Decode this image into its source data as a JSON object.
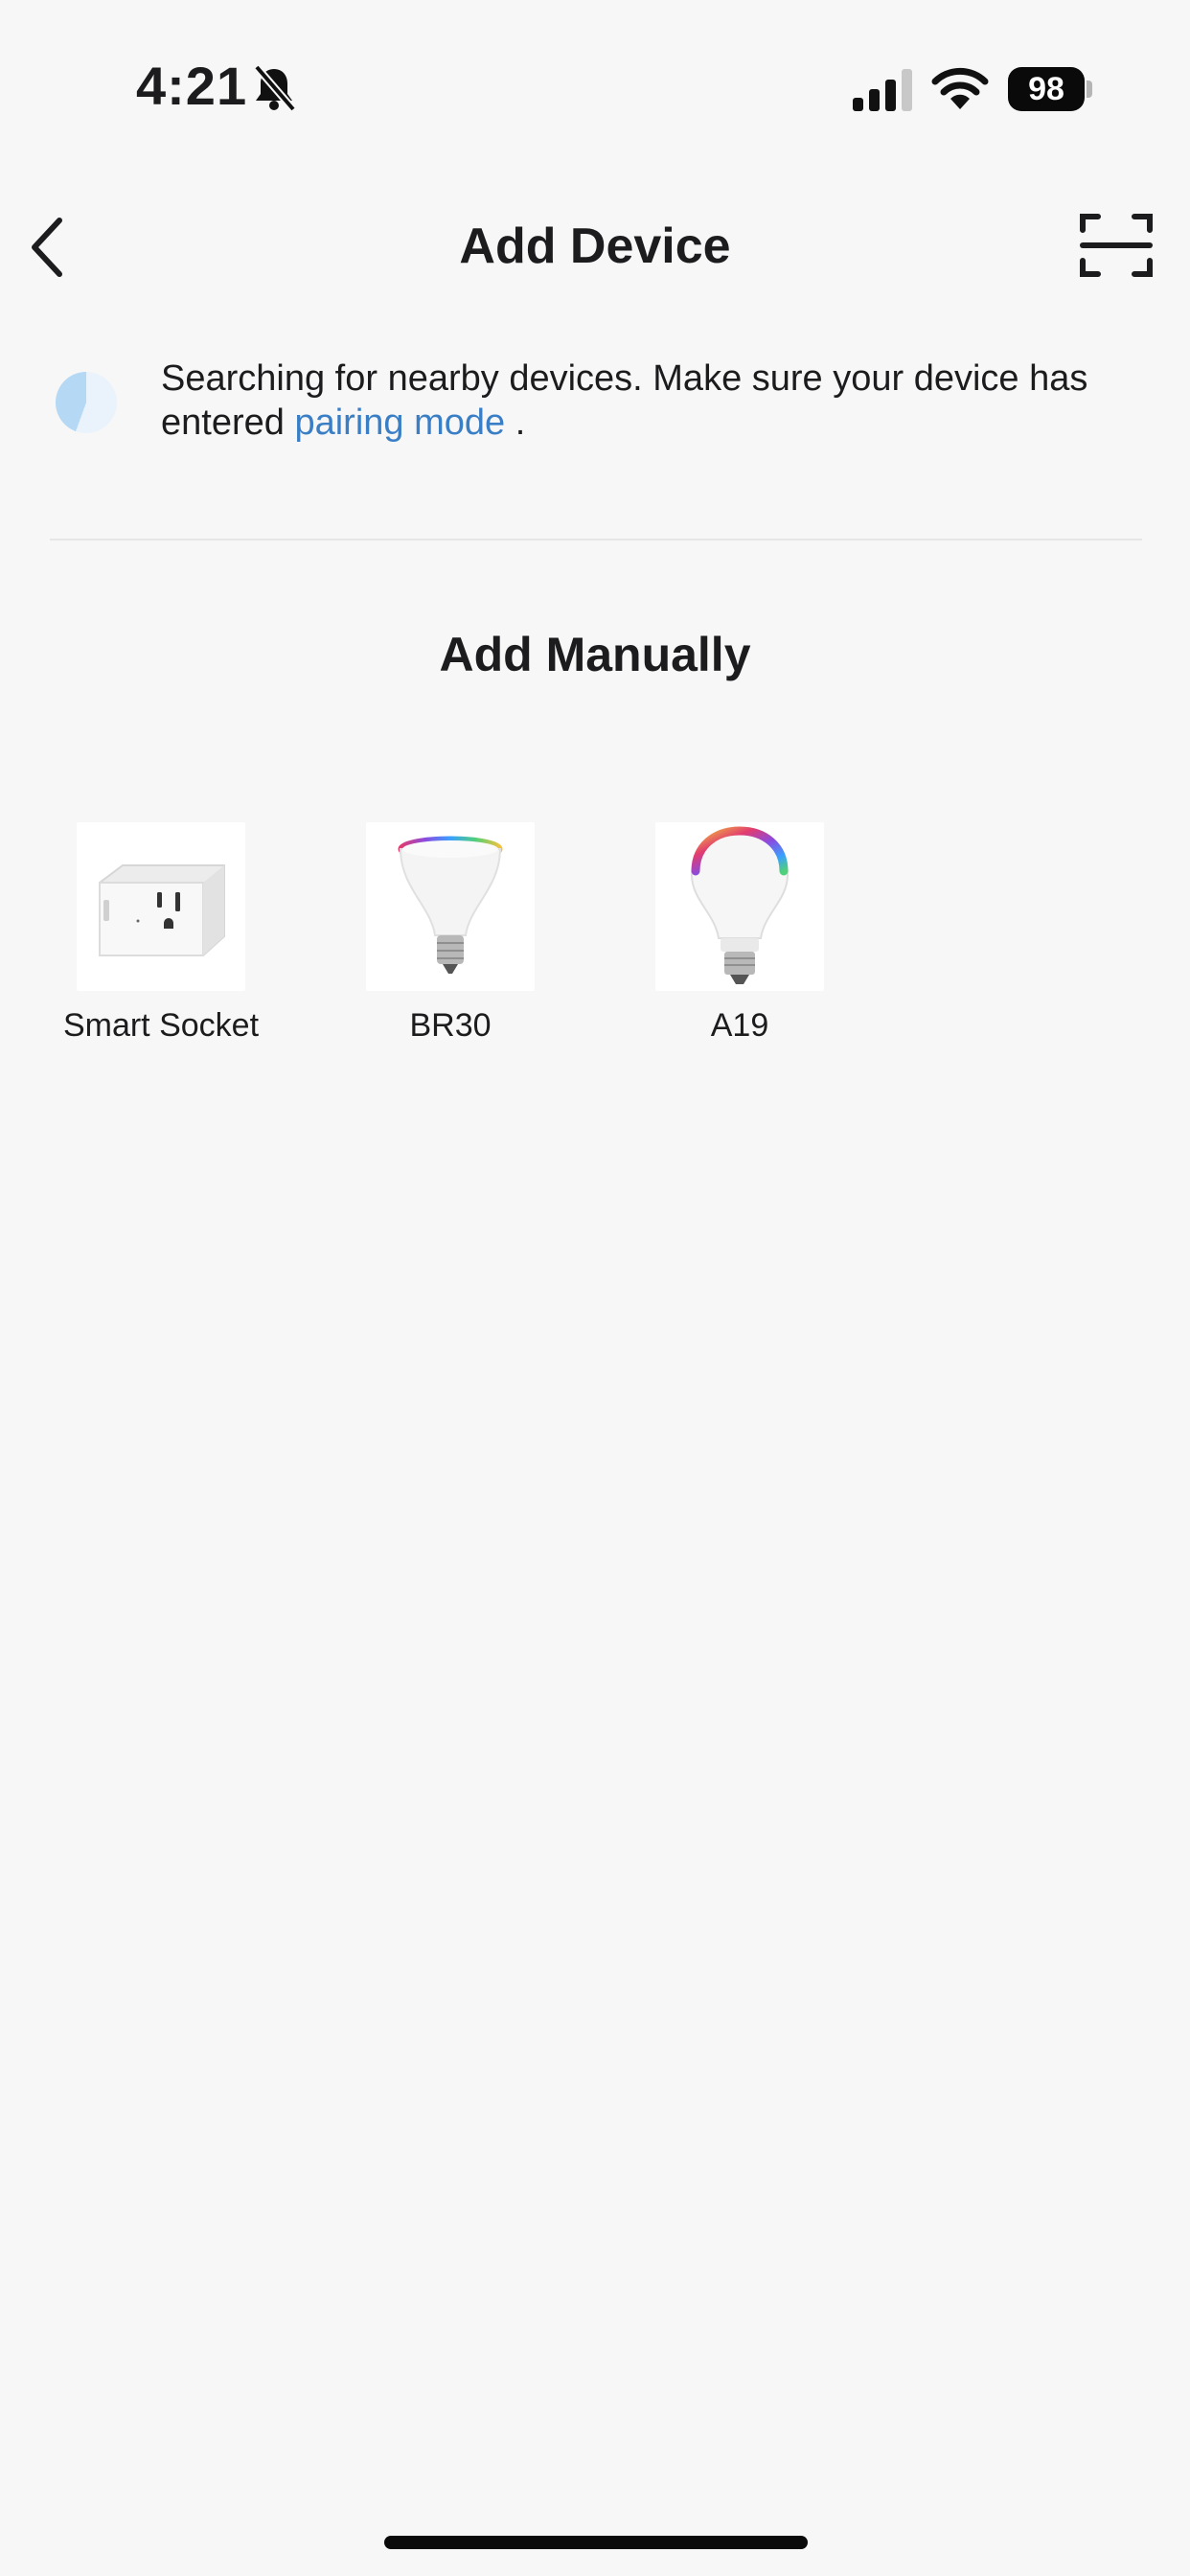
{
  "status_bar": {
    "time": "4:21",
    "battery": "98",
    "icons": [
      "bell-slash-icon",
      "cellular-signal-icon",
      "wifi-icon",
      "battery-icon"
    ]
  },
  "nav": {
    "title": "Add Device",
    "back_icon": "chevron-left-icon",
    "scan_icon": "scan-qr-icon"
  },
  "search_banner": {
    "text_before": "Searching for nearby devices. Make sure your device has entered ",
    "link": "pairing mode",
    "text_after": " ."
  },
  "add_manually": {
    "title": "Add Manually",
    "devices": [
      {
        "label": "Smart Socket",
        "image": "smart-plug"
      },
      {
        "label": "BR30",
        "image": "br30-bulb"
      },
      {
        "label": "A19",
        "image": "a19-bulb"
      }
    ]
  },
  "colors": {
    "background": "#f7f7f7",
    "link": "#3a7fc6",
    "text": "#1c1c1e"
  }
}
